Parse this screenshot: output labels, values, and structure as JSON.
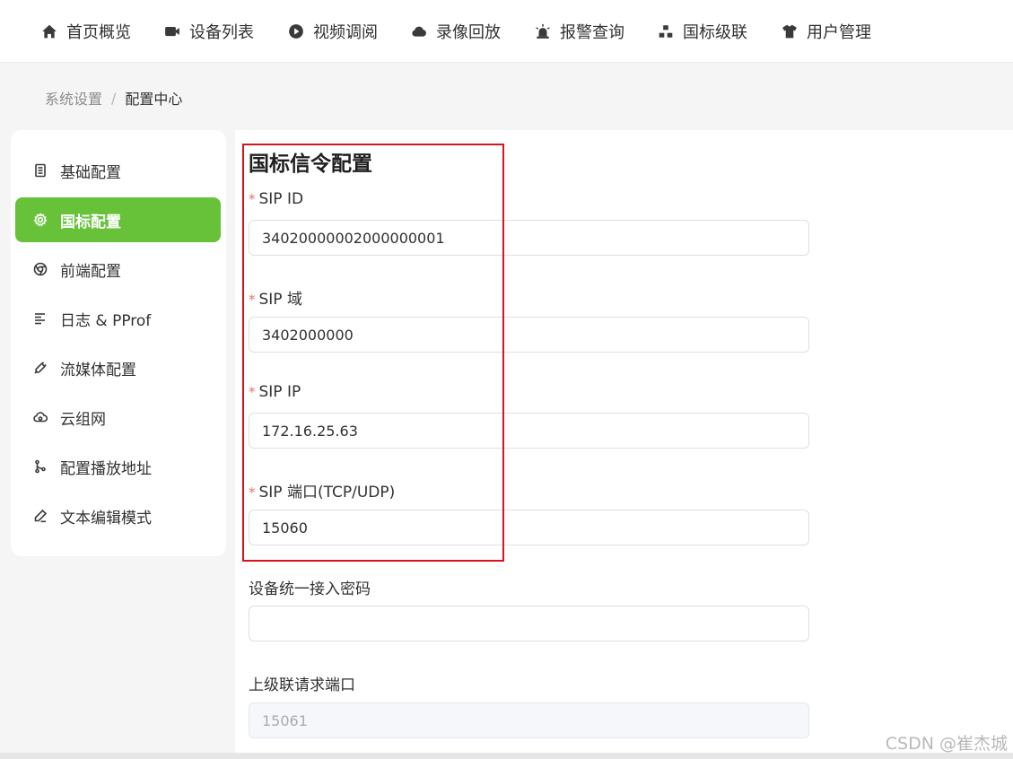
{
  "nav": {
    "items": [
      {
        "label": "首页概览",
        "icon": "home-icon"
      },
      {
        "label": "设备列表",
        "icon": "camera-icon"
      },
      {
        "label": "视频调阅",
        "icon": "play-circle-icon"
      },
      {
        "label": "录像回放",
        "icon": "cloud-icon"
      },
      {
        "label": "报警查询",
        "icon": "alarm-icon"
      },
      {
        "label": "国标级联",
        "icon": "cascade-icon"
      },
      {
        "label": "用户管理",
        "icon": "shirt-icon"
      }
    ]
  },
  "breadcrumb": {
    "parent": "系统设置",
    "separator": "/",
    "current": "配置中心"
  },
  "sidebar": {
    "items": [
      {
        "label": "基础配置",
        "icon": "document-icon",
        "active": false
      },
      {
        "label": "国标配置",
        "icon": "gear-icon",
        "active": true
      },
      {
        "label": "前端配置",
        "icon": "chrome-icon",
        "active": false
      },
      {
        "label": "日志 & PProf",
        "icon": "list-icon",
        "active": false
      },
      {
        "label": "流媒体配置",
        "icon": "link-icon",
        "active": false
      },
      {
        "label": "云组网",
        "icon": "cloud-network-icon",
        "active": false
      },
      {
        "label": "配置播放地址",
        "icon": "branch-icon",
        "active": false
      },
      {
        "label": "文本编辑模式",
        "icon": "edit-pen-icon",
        "active": false
      }
    ],
    "active_color": "#67c23a"
  },
  "form": {
    "title": "国标信令配置",
    "required_mark": "*",
    "fields": [
      {
        "label": "SIP ID",
        "value": "34020000002000000001",
        "required": true
      },
      {
        "label": "SIP 域",
        "value": "3402000000",
        "required": true
      },
      {
        "label": "SIP IP",
        "value": "172.16.25.63",
        "required": true
      },
      {
        "label": "SIP 端口(TCP/UDP)",
        "value": "15060",
        "required": true
      },
      {
        "label": "设备统一接入密码",
        "value": "",
        "required": false
      },
      {
        "label": "上级联请求端口",
        "value": "15061",
        "required": false,
        "disabled": true
      }
    ]
  },
  "watermark": "CSDN @崔杰城",
  "highlight_color": "#d9131c"
}
